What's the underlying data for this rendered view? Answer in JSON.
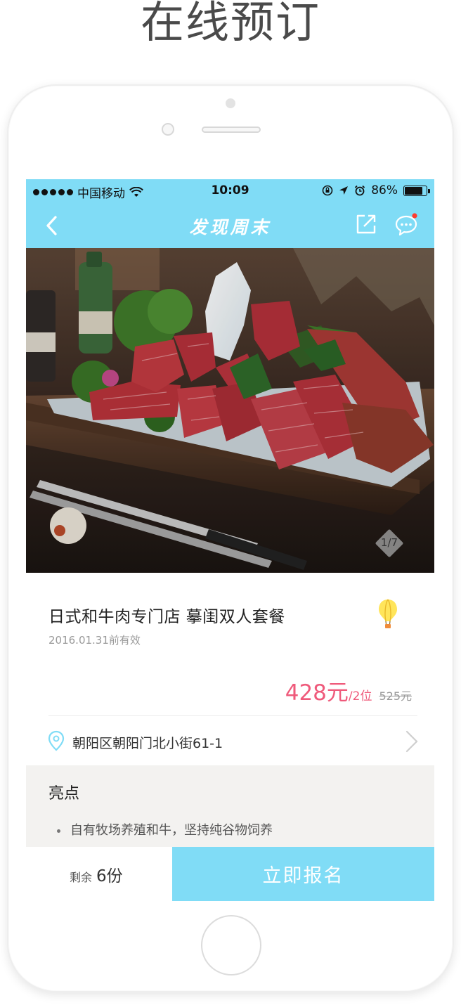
{
  "headline": "在线预订",
  "status_bar": {
    "carrier": "中国移动",
    "time": "10:09",
    "battery": "86%",
    "battery_level": 0.86
  },
  "navbar": {
    "title": "发现周末",
    "icons": [
      "back-arrow-icon",
      "share-icon",
      "chat-icon"
    ]
  },
  "gallery": {
    "counter": "1/7",
    "photo": "wagyu-beef-platter"
  },
  "deal": {
    "title": "日式和牛肉专门店 摹闺双人套餐",
    "valid": "2016.01.31前有效",
    "price": "428元",
    "price_unit": "/2位",
    "original_price": "525元"
  },
  "address": {
    "text": "朝阳区朝阳门北小街61-1"
  },
  "highlights": {
    "title": "亮点",
    "items": [
      "自有牧场养殖和牛，坚持纯谷物饲养"
    ]
  },
  "bottom": {
    "remaining_label": "剩余",
    "remaining_count": "6份",
    "signup_label": "立即报名"
  },
  "colors": {
    "accent": "#80dcf6",
    "price": "#ef5a7b"
  }
}
